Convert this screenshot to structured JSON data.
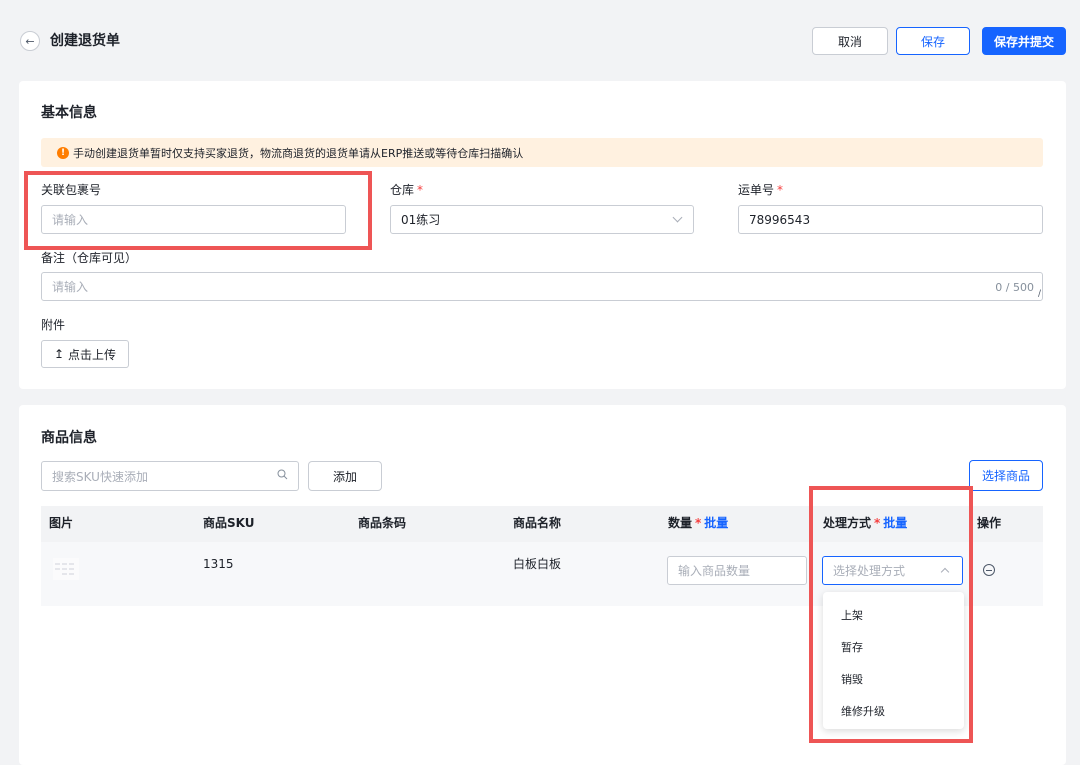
{
  "header": {
    "title": "创建退货单",
    "cancel_label": "取消",
    "save_label": "保存",
    "submit_label": "保存并提交"
  },
  "basic_info": {
    "section_title": "基本信息",
    "notice": "手动创建退货单暂时仅支持买家退货，物流商退货的退货单请从ERP推送或等待仓库扫描确认",
    "package_no": {
      "label": "关联包裹号",
      "placeholder": "请输入",
      "value": ""
    },
    "warehouse": {
      "label": "仓库",
      "required_mark": "*",
      "value": "01练习"
    },
    "tracking_no": {
      "label": "运单号",
      "required_mark": "*",
      "value": "78996543"
    },
    "remark": {
      "label": "备注（仓库可见）",
      "placeholder": "请输入",
      "counter": "0 / 500"
    },
    "attachment": {
      "label": "附件",
      "upload_label": "点击上传"
    }
  },
  "products": {
    "section_title": "商品信息",
    "search_placeholder": "搜索SKU快速添加",
    "add_label": "添加",
    "select_label": "选择商品",
    "columns": {
      "image": "图片",
      "sku": "商品SKU",
      "barcode": "商品条码",
      "name": "商品名称",
      "qty": "数量",
      "handling": "处理方式",
      "actions": "操作",
      "required_mark": "*",
      "batch_label": "批量"
    },
    "rows": [
      {
        "sku": "1315",
        "barcode": "",
        "name": "白板白板",
        "qty_placeholder": "输入商品数量",
        "handling_placeholder": "选择处理方式"
      }
    ],
    "handling_options": [
      "上架",
      "暂存",
      "销毁",
      "维修升级"
    ]
  },
  "colors": {
    "primary": "#1664ff",
    "required": "#f53f3f",
    "notice_bg": "#fff1e0",
    "notice_icon": "#ff7d00",
    "highlight_box": "#ee5555"
  }
}
